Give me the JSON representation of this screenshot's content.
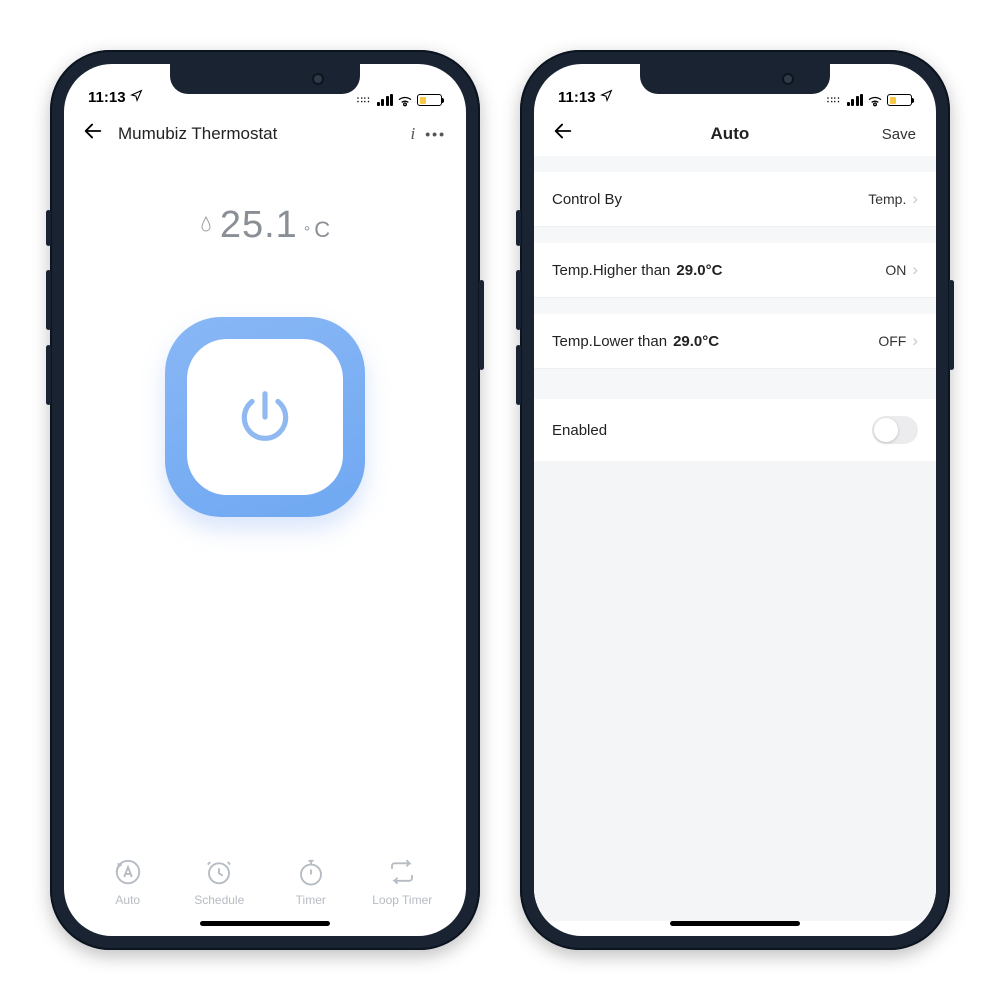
{
  "status": {
    "time": "11:13"
  },
  "left": {
    "header": {
      "title": "Mumubiz Thermostat"
    },
    "temperature": {
      "value": "25.1",
      "unit_deg": "°",
      "unit_c": "C"
    },
    "nav": {
      "auto": "Auto",
      "schedule": "Schedule",
      "timer": "Timer",
      "loop": "Loop Timer"
    }
  },
  "right": {
    "header": {
      "title": "Auto",
      "save": "Save"
    },
    "rows": {
      "control_by": {
        "label": "Control By",
        "value": "Temp."
      },
      "higher": {
        "label": "Temp.Higher than",
        "threshold": "29.0°C",
        "action": "ON"
      },
      "lower": {
        "label": "Temp.Lower than",
        "threshold": "29.0°C",
        "action": "OFF"
      },
      "enabled": {
        "label": "Enabled"
      }
    }
  }
}
